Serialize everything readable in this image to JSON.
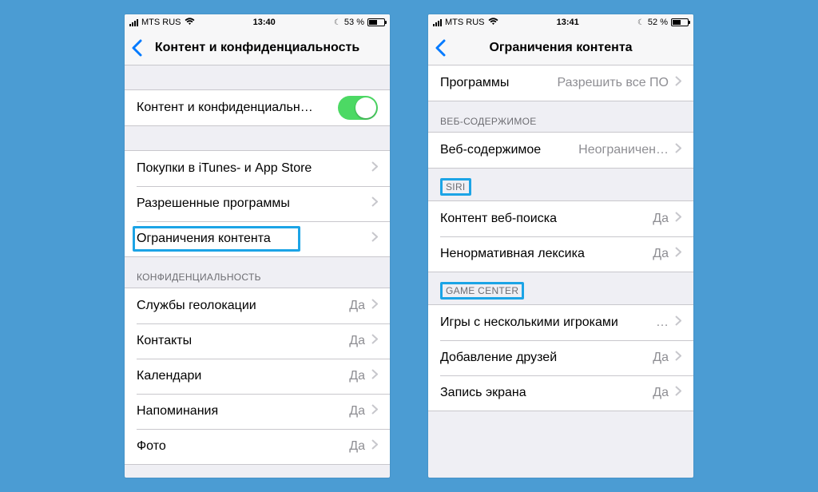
{
  "left": {
    "status": {
      "carrier": "MTS RUS",
      "time": "13:40",
      "battery_text": "53 %"
    },
    "nav_title": "Контент и конфиденциальность",
    "toggle_row": {
      "label": "Контент и конфиденциальн…"
    },
    "group1": [
      {
        "label": "Покупки в iTunes- и App Store"
      },
      {
        "label": "Разрешенные программы"
      },
      {
        "label": "Ограничения контента"
      }
    ],
    "privacy_header": "КОНФИДЕНЦИАЛЬНОСТЬ",
    "group2": [
      {
        "label": "Службы геолокации",
        "value": "Да"
      },
      {
        "label": "Контакты",
        "value": "Да"
      },
      {
        "label": "Календари",
        "value": "Да"
      },
      {
        "label": "Напоминания",
        "value": "Да"
      },
      {
        "label": "Фото",
        "value": "Да"
      }
    ]
  },
  "right": {
    "status": {
      "carrier": "MTS RUS",
      "time": "13:41",
      "battery_text": "52 %"
    },
    "nav_title": "Ограничения контента",
    "row_apps": {
      "label": "Программы",
      "value": "Разрешить все ПО"
    },
    "web_header": "ВЕБ-СОДЕРЖИМОЕ",
    "row_web": {
      "label": "Веб-содержимое",
      "value": "Неограничен…"
    },
    "siri_header": "SIRI",
    "group_siri": [
      {
        "label": "Контент веб-поиска",
        "value": "Да"
      },
      {
        "label": "Ненормативная лексика",
        "value": "Да"
      }
    ],
    "gc_header": "GAME CENTER",
    "group_gc": [
      {
        "label": "Игры с несколькими игроками",
        "value": "…"
      },
      {
        "label": "Добавление друзей",
        "value": "Да"
      },
      {
        "label": "Запись экрана",
        "value": "Да"
      }
    ]
  }
}
